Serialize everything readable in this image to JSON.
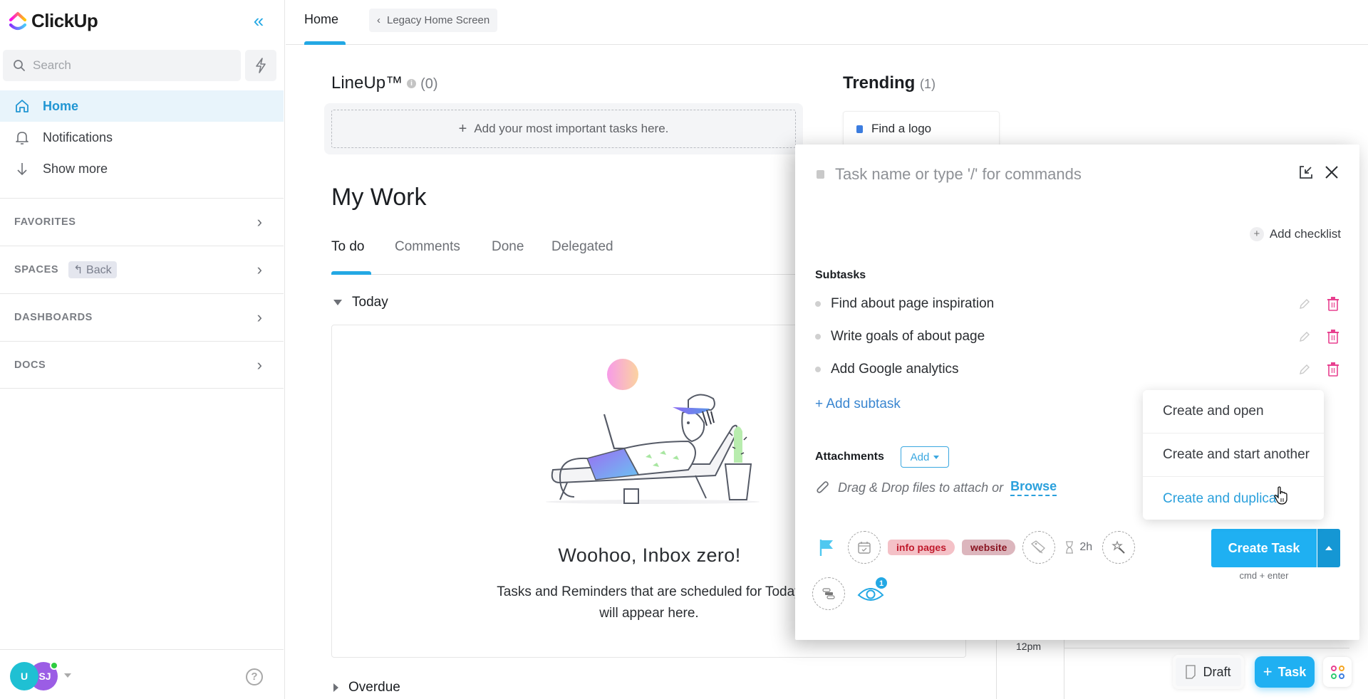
{
  "app": {
    "name": "ClickUp"
  },
  "sidebar": {
    "search_placeholder": "Search",
    "nav": [
      {
        "label": "Home",
        "icon": "home-icon",
        "active": true
      },
      {
        "label": "Notifications",
        "icon": "bell-icon",
        "active": false
      },
      {
        "label": "Show more",
        "icon": "arrow-down-icon",
        "active": false
      }
    ],
    "sections": [
      {
        "label": "FAVORITES"
      },
      {
        "label": "SPACES",
        "back_label": "Back"
      },
      {
        "label": "DASHBOARDS"
      },
      {
        "label": "DOCS"
      }
    ],
    "footer": {
      "avatars": [
        {
          "initials": "U",
          "color": "#1fc0d3"
        },
        {
          "initials": "SJ",
          "color": "#9b5de5",
          "online": true
        }
      ],
      "help_label": "?"
    }
  },
  "header": {
    "tab_label": "Home",
    "legacy_label": "Legacy Home Screen"
  },
  "lineup": {
    "title": "LineUp™",
    "info_icon": "i",
    "count": "(0)",
    "placeholder": "Add your most important tasks here."
  },
  "trending": {
    "title": "Trending",
    "count": "(1)",
    "items": [
      {
        "label": "Find a logo",
        "color": "#3c7de0"
      }
    ]
  },
  "my_work": {
    "title": "My Work",
    "tabs": [
      {
        "label": "To do",
        "active": true
      },
      {
        "label": "Comments",
        "active": false
      },
      {
        "label": "Done",
        "active": false
      },
      {
        "label": "Delegated",
        "active": false
      }
    ],
    "groups": {
      "today": "Today",
      "overdue": "Overdue"
    },
    "empty_title": "Woohoo, Inbox zero!",
    "empty_subtitle": "Tasks and Reminders that are scheduled for Today will appear here."
  },
  "calendar": {
    "time_label": "12pm"
  },
  "task_modal": {
    "name_placeholder": "Task name or type '/' for commands",
    "add_checklist": "Add checklist",
    "subtasks_label": "Subtasks",
    "subtasks": [
      {
        "label": "Find about page inspiration"
      },
      {
        "label": "Write goals of about page"
      },
      {
        "label": "Add Google analytics"
      }
    ],
    "add_subtask": "+ Add subtask",
    "attachments_label": "Attachments",
    "attachments_add": "Add",
    "drop_text": "Drag & Drop files to attach or",
    "browse_label": "Browse",
    "tags": [
      {
        "label": "info pages"
      },
      {
        "label": "website"
      }
    ],
    "time_estimate": "2h",
    "watchers_count": "1",
    "priority_color": "#4fc8f0",
    "create_button": "Create Task",
    "create_hint": "cmd + enter",
    "create_menu": [
      {
        "label": "Create and open",
        "hover": false
      },
      {
        "label": "Create and start another",
        "hover": false
      },
      {
        "label": "Create and duplicate",
        "hover": true
      }
    ]
  },
  "bottom_bar": {
    "draft_label": "Draft",
    "task_label": "Task"
  },
  "colors": {
    "accent": "#23a8e4",
    "primary_button": "#1fb0f2",
    "delete_icon": "#e8408f"
  }
}
